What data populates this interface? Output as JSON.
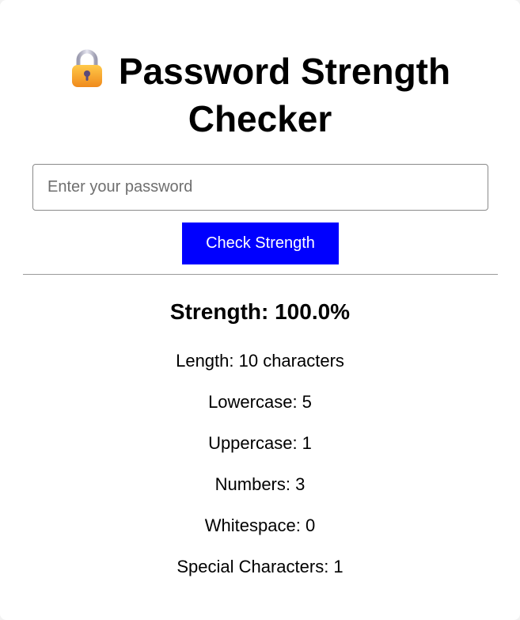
{
  "header": {
    "title_line1": "Password Strength",
    "title_line2": "Checker",
    "icon": "lock-icon"
  },
  "form": {
    "password_value": "",
    "password_placeholder": "Enter your password",
    "check_button_label": "Check Strength"
  },
  "result": {
    "strength_text": "Strength: 100.0%",
    "stats": [
      "Length: 10 characters",
      "Lowercase: 5",
      "Uppercase: 1",
      "Numbers: 3",
      "Whitespace: 0",
      "Special Characters: 1"
    ]
  },
  "colors": {
    "button_background": "#0000ff",
    "lock_body": "#f5a623",
    "lock_shackle": "#b8b8c8"
  }
}
